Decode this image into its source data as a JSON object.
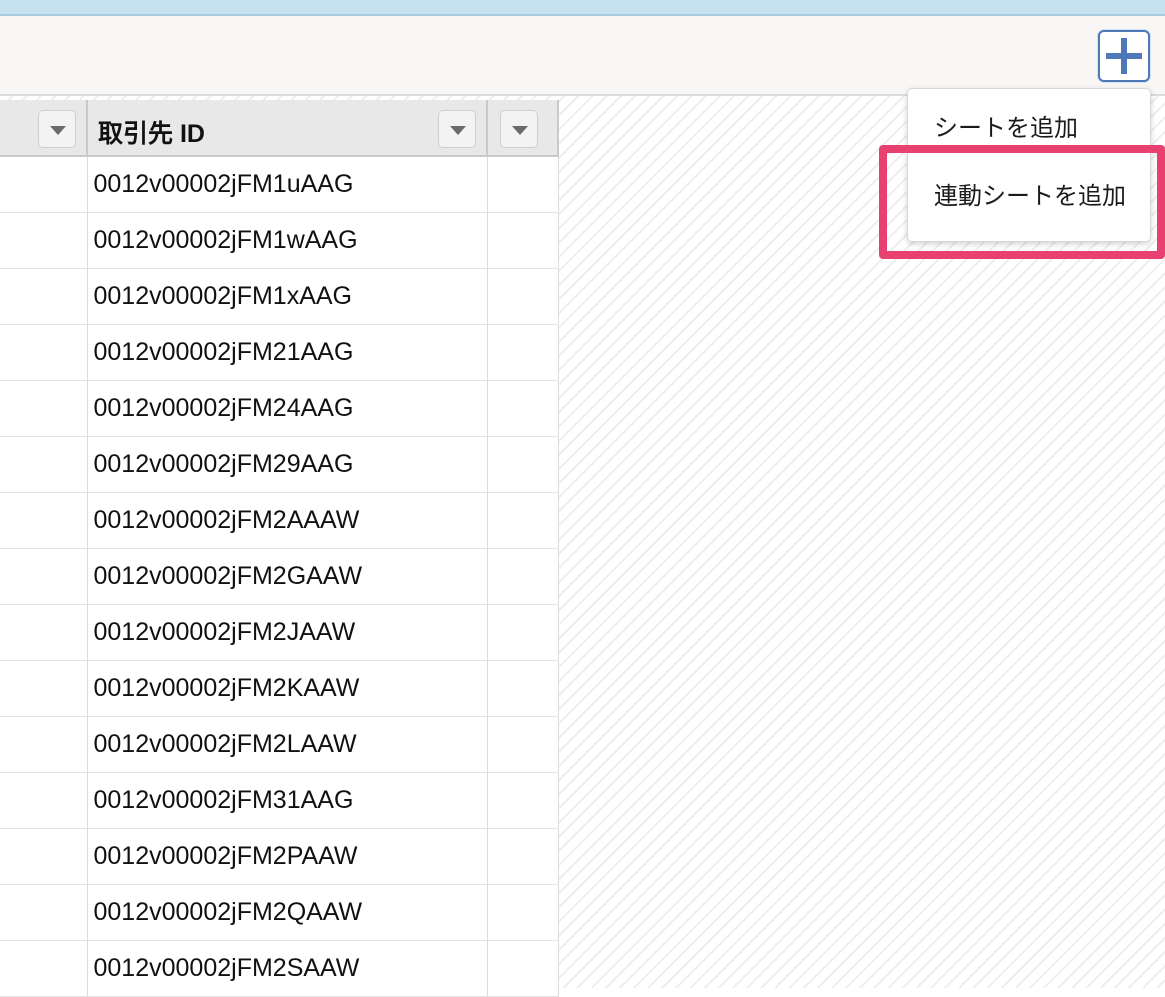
{
  "grid": {
    "columns": [
      {
        "label": ""
      },
      {
        "label": "取引先 ID"
      },
      {
        "label": ""
      }
    ],
    "rows": [
      "0012v00002jFM1uAAG",
      "0012v00002jFM1wAAG",
      "0012v00002jFM1xAAG",
      "0012v00002jFM21AAG",
      "0012v00002jFM24AAG",
      "0012v00002jFM29AAG",
      "0012v00002jFM2AAAW",
      "0012v00002jFM2GAAW",
      "0012v00002jFM2JAAW",
      "0012v00002jFM2KAAW",
      "0012v00002jFM2LAAW",
      "0012v00002jFM31AAG",
      "0012v00002jFM2PAAW",
      "0012v00002jFM2QAAW",
      "0012v00002jFM2SAAW"
    ]
  },
  "toolbar": {
    "add_icon": "plus-icon",
    "accent_color": "#4f78b8"
  },
  "menu": {
    "items": [
      {
        "label": "シートを追加"
      },
      {
        "label": "連動シートを追加"
      }
    ],
    "highlight_color": "#e8416f"
  }
}
